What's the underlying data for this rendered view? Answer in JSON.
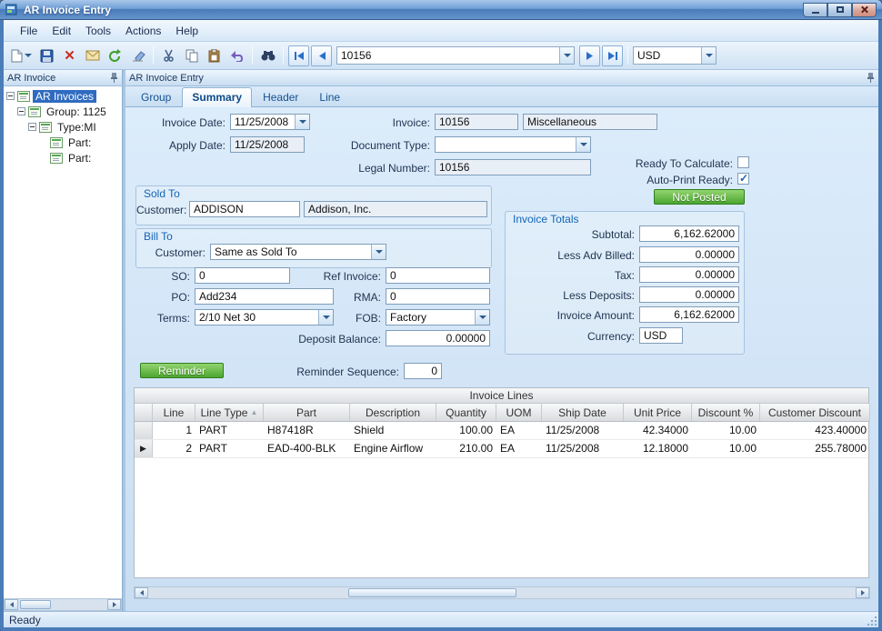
{
  "window": {
    "title": "AR Invoice Entry"
  },
  "menu": {
    "items": [
      "File",
      "Edit",
      "Tools",
      "Actions",
      "Help"
    ]
  },
  "toolbar": {
    "record_value": "10156",
    "currency_value": "USD"
  },
  "left_panel": {
    "title": "AR Invoice",
    "tree": {
      "items": [
        {
          "label": "AR Invoices"
        },
        {
          "label": "Group: 1125"
        },
        {
          "label": "Type:MI"
        },
        {
          "label": "Part:"
        },
        {
          "label": "Part:"
        }
      ]
    }
  },
  "main": {
    "title": "AR Invoice Entry",
    "tabs": [
      {
        "label": "Group"
      },
      {
        "label": "Summary"
      },
      {
        "label": "Header"
      },
      {
        "label": "Line"
      }
    ]
  },
  "form": {
    "invoice_date": {
      "label": "Invoice Date:",
      "value": "11/25/2008"
    },
    "apply_date": {
      "label": "Apply Date:",
      "value": "11/25/2008"
    },
    "invoice": {
      "label": "Invoice:",
      "value": "10156",
      "description": "Miscellaneous"
    },
    "document_type": {
      "label": "Document Type:",
      "value": ""
    },
    "legal_number": {
      "label": "Legal Number:",
      "value": "10156"
    },
    "ready_to_calculate": {
      "label": "Ready To Calculate:"
    },
    "auto_print_ready": {
      "label": "Auto-Print Ready:"
    },
    "posted_status": "Not Posted",
    "sold_to": {
      "title": "Sold To",
      "customer_label": "Customer:",
      "customer_id": "ADDISON",
      "customer_name": "Addison, Inc."
    },
    "bill_to": {
      "title": "Bill To",
      "customer_label": "Customer:",
      "customer_value": "Same as Sold To"
    },
    "so": {
      "label": "SO:",
      "value": "0"
    },
    "ref_invoice": {
      "label": "Ref Invoice:",
      "value": "0"
    },
    "po": {
      "label": "PO:",
      "value": "Add234"
    },
    "rma": {
      "label": "RMA:",
      "value": "0"
    },
    "terms": {
      "label": "Terms:",
      "value": "2/10 Net 30"
    },
    "fob": {
      "label": "FOB:",
      "value": "Factory"
    },
    "deposit_balance": {
      "label": "Deposit Balance:",
      "value": "0.00000"
    },
    "totals": {
      "title": "Invoice Totals",
      "rows": [
        {
          "label": "Subtotal:",
          "value": "6,162.62000"
        },
        {
          "label": "Less Adv Billed:",
          "value": "0.00000"
        },
        {
          "label": "Tax:",
          "value": "0.00000"
        },
        {
          "label": "Less Deposits:",
          "value": "0.00000"
        },
        {
          "label": "Invoice Amount:",
          "value": "6,162.62000"
        },
        {
          "label": "Currency:",
          "value": "USD"
        }
      ]
    },
    "reminder": {
      "button": "Reminder",
      "sequence_label": "Reminder Sequence:",
      "sequence_value": "0"
    }
  },
  "grid": {
    "title": "Invoice Lines",
    "columns": [
      "Line",
      "Line Type",
      "Part",
      "Description",
      "Quantity",
      "UOM",
      "Ship Date",
      "Unit Price",
      "Discount %",
      "Customer Discount"
    ],
    "rows": [
      [
        "1",
        "PART",
        "H87418R",
        "Shield",
        "100.00",
        "EA",
        "11/25/2008",
        "42.34000",
        "10.00",
        "423.40000"
      ],
      [
        "2",
        "PART",
        "EAD-400-BLK",
        "Engine Airflow",
        "210.00",
        "EA",
        "11/25/2008",
        "12.18000",
        "10.00",
        "255.78000"
      ]
    ]
  },
  "status": {
    "text": "Ready"
  }
}
